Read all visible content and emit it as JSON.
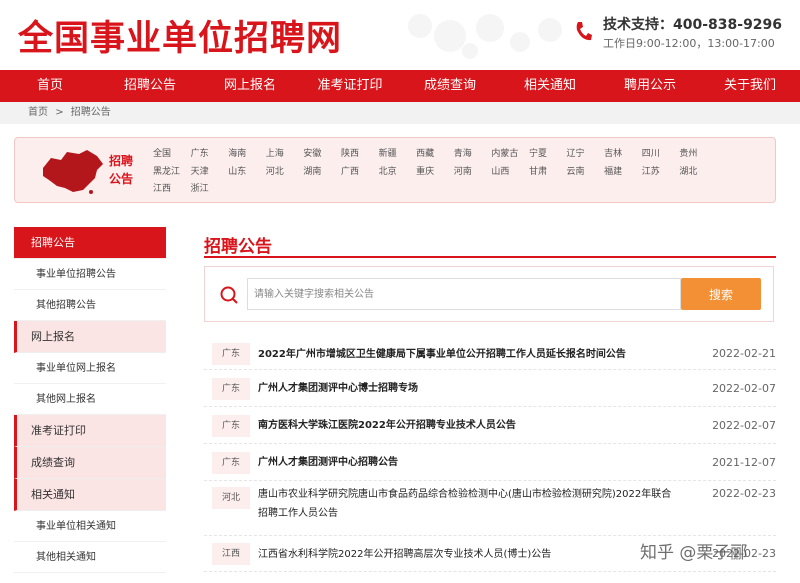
{
  "header": {
    "logo": "全国事业单位招聘网",
    "support_label": "技术支持：400-838-9296",
    "hours": "工作日9:00-12:00，13:00-17:00"
  },
  "nav": [
    "首页",
    "招聘公告",
    "网上报名",
    "准考证打印",
    "成绩查询",
    "相关通知",
    "聘用公示",
    "关于我们"
  ],
  "breadcrumb": [
    "首页",
    ">",
    "招聘公告"
  ],
  "region": {
    "title_line1": "招聘",
    "title_line2": "公告",
    "provinces": [
      "全国",
      "广东",
      "海南",
      "上海",
      "安徽",
      "陕西",
      "新疆",
      "西藏",
      "青海",
      "内蒙古",
      "宁夏",
      "辽宁",
      "吉林",
      "四川",
      "贵州",
      "黑龙江",
      "天津",
      "山东",
      "河北",
      "湖南",
      "广西",
      "北京",
      "重庆",
      "河南",
      "山西",
      "甘肃",
      "云南",
      "福建",
      "江苏",
      "湖北",
      "江西",
      "浙江"
    ]
  },
  "sidebar": [
    {
      "label": "招聘公告",
      "active": true,
      "subs": [
        "事业单位招聘公告",
        "其他招聘公告"
      ]
    },
    {
      "label": "网上报名",
      "active": false,
      "subs": [
        "事业单位网上报名",
        "其他网上报名"
      ]
    },
    {
      "label": "准考证打印",
      "active": false,
      "subs": []
    },
    {
      "label": "成绩查询",
      "active": false,
      "subs": []
    },
    {
      "label": "相关通知",
      "active": false,
      "subs": [
        "事业单位相关通知",
        "其他相关通知"
      ]
    }
  ],
  "main": {
    "title": "招聘公告",
    "search_placeholder": "请输入关键字搜索相关公告",
    "search_button": "搜索"
  },
  "announcements": [
    {
      "region": "广东",
      "title": "2022年广州市增城区卫生健康局下属事业单位公开招聘工作人员延长报名时间公告",
      "date": "2022-02-21",
      "bold": true
    },
    {
      "region": "广东",
      "title": "广州人才集团测评中心博士招聘专场",
      "date": "2022-02-07",
      "bold": true
    },
    {
      "region": "广东",
      "title": "南方医科大学珠江医院2022年公开招聘专业技术人员公告",
      "date": "2022-02-07",
      "bold": true
    },
    {
      "region": "广东",
      "title": "广州人才集团测评中心招聘公告",
      "date": "2021-12-07",
      "bold": true
    },
    {
      "region": "河北",
      "title": "唐山市农业科学研究院唐山市食品药品综合检验检测中心(唐山市检验检测研究院)2022年联合招聘工作人员公告",
      "date": "2022-02-23",
      "bold": false
    },
    {
      "region": "江西",
      "title": "江西省水利科学院2022年公开招聘高层次专业技术人员(博士)公告",
      "date": "2022-02-23",
      "bold": false
    }
  ],
  "watermark": "知乎 @栗子郦"
}
